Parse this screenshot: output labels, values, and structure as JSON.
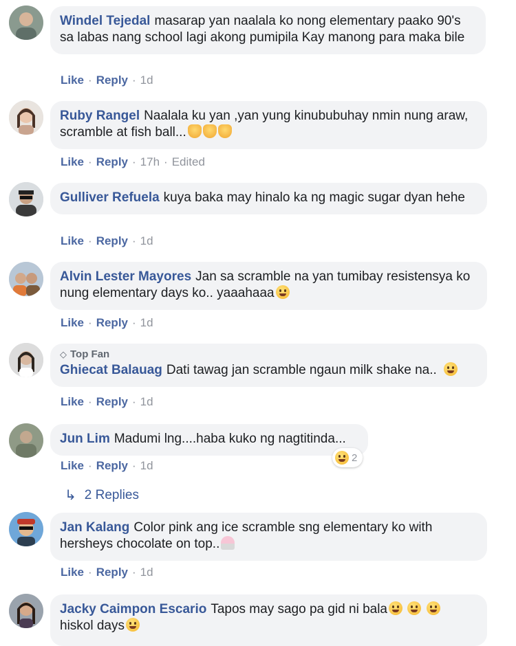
{
  "comments": [
    {
      "author": "Windel Tejedal",
      "text": "masarap yan naalala ko nong elementary paako 90's sa labas nang school lagi akong pumipila Kay manong para maka bile",
      "actions": {
        "like": "Like",
        "reply": "Reply",
        "time": "1d"
      }
    },
    {
      "author": "Ruby Rangel",
      "text": "Naalala ku yan ,yan yung kinububuhay nmin nung araw, scramble at fish ball...",
      "actions": {
        "like": "Like",
        "reply": "Reply",
        "time": "17h",
        "edited": "Edited"
      }
    },
    {
      "author": "Gulliver Refuela",
      "text": "kuya baka may hinalo ka ng magic sugar dyan hehe",
      "actions": {
        "like": "Like",
        "reply": "Reply",
        "time": "1d"
      }
    },
    {
      "author": "Alvin Lester Mayores",
      "text": "Jan sa scramble na yan tumibay resistensya ko nung elementary days ko.. yaaahaaa",
      "actions": {
        "like": "Like",
        "reply": "Reply",
        "time": "1d"
      }
    },
    {
      "badge": "Top Fan",
      "author": "Ghiecat Balauag",
      "text": "Dati tawag jan scramble ngaun milk shake na..",
      "actions": {
        "like": "Like",
        "reply": "Reply",
        "time": "1d"
      }
    },
    {
      "author": "Jun Lim",
      "text": "Madumi lng....haba kuko ng nagtitinda...",
      "reaction_count": "2",
      "actions": {
        "like": "Like",
        "reply": "Reply",
        "time": "1d"
      }
    },
    {
      "author": "Jan Kalang",
      "text": "Color pink ang ice scramble sng elementary ko with hersheys chocolate on top..",
      "actions": {
        "like": "Like",
        "reply": "Reply",
        "time": "1d"
      }
    },
    {
      "author": "Jacky Caimpon Escario",
      "text": "Tapos may sago pa gid ni bala",
      "text2": "hiskol days",
      "actions": {
        "like": "Like",
        "reply": "Reply",
        "time": "1d"
      }
    }
  ],
  "replies_link": {
    "label": "2 Replies",
    "icon": "reply-arrow-icon"
  },
  "colors": {
    "link": "#385898",
    "bubble": "#f2f3f5",
    "meta": "#90949c"
  }
}
